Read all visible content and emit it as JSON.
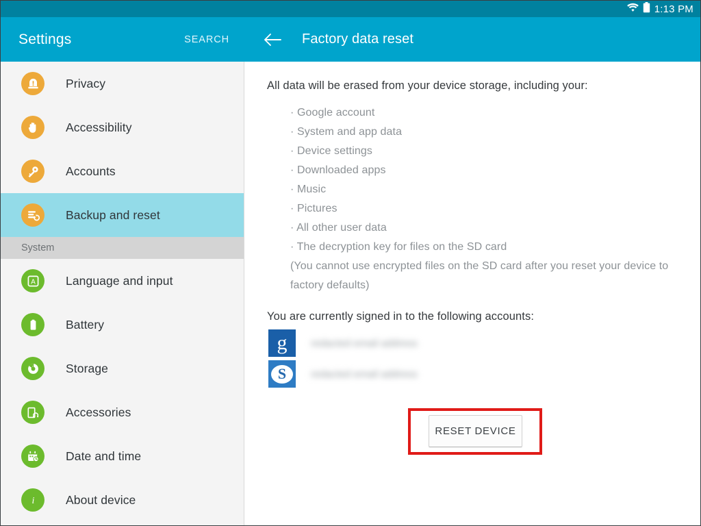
{
  "status_bar": {
    "time": "1:13 PM",
    "wifi_icon": "wifi-icon",
    "battery_icon": "battery-icon",
    "background_color": "#00819f"
  },
  "left_panel": {
    "title": "Settings",
    "search_label": "SEARCH",
    "appbar_color": "#00a4cc",
    "selected_highlight_color": "#93dbe8",
    "items": [
      {
        "label": "Privacy",
        "icon": "privacy-icon",
        "icon_color": "#eda93a",
        "selected": false
      },
      {
        "label": "Accessibility",
        "icon": "accessibility-hand-icon",
        "icon_color": "#eda93a",
        "selected": false
      },
      {
        "label": "Accounts",
        "icon": "key-icon",
        "icon_color": "#eda93a",
        "selected": false
      },
      {
        "label": "Backup and reset",
        "icon": "backup-reset-icon",
        "icon_color": "#eda93a",
        "selected": true
      }
    ],
    "section_header": "System",
    "system_items": [
      {
        "label": "Language and input",
        "icon": "language-a-icon",
        "icon_color": "#6cbb2d"
      },
      {
        "label": "Battery",
        "icon": "battery-icon",
        "icon_color": "#6cbb2d"
      },
      {
        "label": "Storage",
        "icon": "storage-disc-icon",
        "icon_color": "#6cbb2d"
      },
      {
        "label": "Accessories",
        "icon": "accessories-icon",
        "icon_color": "#6cbb2d"
      },
      {
        "label": "Date and time",
        "icon": "calendar-clock-icon",
        "icon_color": "#6cbb2d"
      },
      {
        "label": "About device",
        "icon": "info-icon",
        "icon_color": "#6cbb2d"
      }
    ]
  },
  "detail_panel": {
    "back_icon": "back-arrow-icon",
    "title": "Factory data reset",
    "erase_intro": "All data will be erased from your device storage, including your:",
    "erase_items": [
      "· Google account",
      "· System and app data",
      "· Device settings",
      "· Downloaded apps",
      "· Music",
      "· Pictures",
      "· All other user data",
      "· The decryption key for files on the SD card"
    ],
    "erase_note": "(You cannot use encrypted files on the SD card after you reset your device to factory defaults)",
    "accounts_intro": "You are currently signed in to the following accounts:",
    "accounts": [
      {
        "icon": "google-account-icon",
        "glyph": "g",
        "email": "redacted email address"
      },
      {
        "icon": "skype-account-icon",
        "glyph": "S",
        "email": "redacted email address"
      }
    ],
    "reset_button_label": "RESET DEVICE",
    "annotation_color": "#e01b18"
  }
}
